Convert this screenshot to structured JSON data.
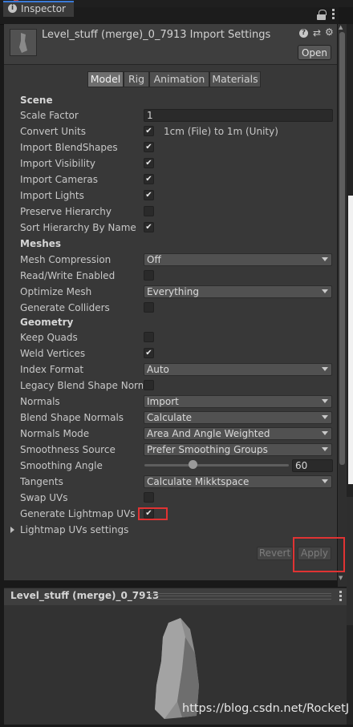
{
  "window": {
    "tab_title": "Inspector"
  },
  "header": {
    "title": "Level_stuff (merge)_0_7913 Import Settings",
    "open_label": "Open",
    "help_label": "?"
  },
  "tabs": [
    "Model",
    "Rig",
    "Animation",
    "Materials"
  ],
  "selected_tab": "Model",
  "sections": {
    "scene": "Scene",
    "meshes": "Meshes",
    "geometry": "Geometry"
  },
  "rows": {
    "scale_factor": {
      "label": "Scale Factor",
      "value": "1"
    },
    "convert_units": {
      "label": "Convert Units",
      "checked": true,
      "note": "1cm (File) to 1m (Unity)"
    },
    "import_blendshapes": {
      "label": "Import BlendShapes",
      "checked": true
    },
    "import_visibility": {
      "label": "Import Visibility",
      "checked": true
    },
    "import_cameras": {
      "label": "Import Cameras",
      "checked": true
    },
    "import_lights": {
      "label": "Import Lights",
      "checked": true
    },
    "preserve_hierarchy": {
      "label": "Preserve Hierarchy",
      "checked": false
    },
    "sort_hierarchy": {
      "label": "Sort Hierarchy By Name",
      "checked": true
    },
    "mesh_compression": {
      "label": "Mesh Compression",
      "value": "Off"
    },
    "read_write": {
      "label": "Read/Write Enabled",
      "checked": false
    },
    "optimize_mesh": {
      "label": "Optimize Mesh",
      "value": "Everything"
    },
    "generate_colliders": {
      "label": "Generate Colliders",
      "checked": false
    },
    "keep_quads": {
      "label": "Keep Quads",
      "checked": false
    },
    "weld_vertices": {
      "label": "Weld Vertices",
      "checked": true
    },
    "index_format": {
      "label": "Index Format",
      "value": "Auto"
    },
    "legacy_blend": {
      "label": "Legacy Blend Shape Normals",
      "checked": false
    },
    "normals": {
      "label": "Normals",
      "value": "Import"
    },
    "blend_shape_normals": {
      "label": "Blend Shape Normals",
      "value": "Calculate"
    },
    "normals_mode": {
      "label": "Normals Mode",
      "value": "Area And Angle Weighted"
    },
    "smoothness_source": {
      "label": "Smoothness Source",
      "value": "Prefer Smoothing Groups"
    },
    "smoothing_angle": {
      "label": "Smoothing Angle",
      "value": "60",
      "fraction": 0.33
    },
    "tangents": {
      "label": "Tangents",
      "value": "Calculate Mikktspace"
    },
    "swap_uvs": {
      "label": "Swap UVs",
      "checked": false
    },
    "generate_lightmap_uvs": {
      "label": "Generate Lightmap UVs",
      "checked": true
    },
    "lightmap_settings": {
      "label": "Lightmap UVs settings"
    }
  },
  "footer": {
    "revert_label": "Revert",
    "apply_label": "Apply"
  },
  "preview": {
    "title": "Level_stuff (merge)_0_7913"
  },
  "watermark": "https://blog.csdn.net/RocketJ",
  "colors": {
    "highlight": "#e03333",
    "tab_accent": "#3a7ad8",
    "panel": "#383838"
  }
}
